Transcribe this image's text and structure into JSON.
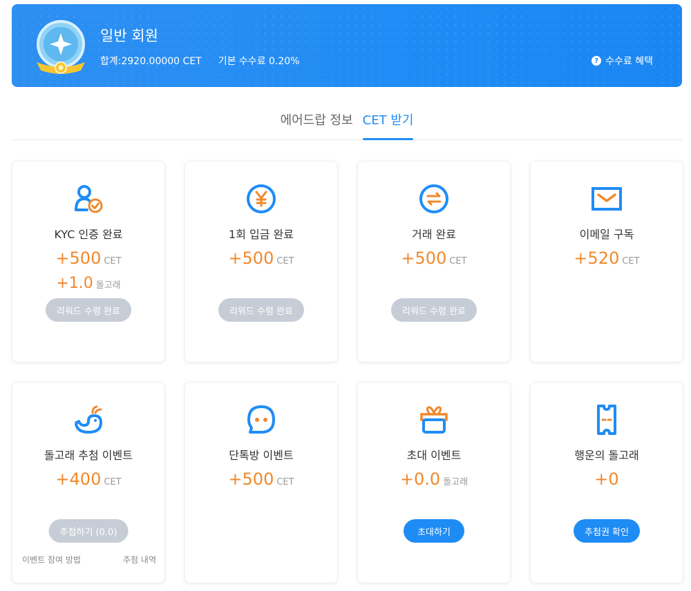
{
  "banner": {
    "title": "일반 회원",
    "total": "합계:2920.00000 CET",
    "fee": "기본 수수료 0.20%",
    "benefit_label": "수수료 혜택"
  },
  "tabs": [
    {
      "label": "에어드랍 정보"
    },
    {
      "label": "CET 받기",
      "active": true
    }
  ],
  "cards": [
    {
      "title": "KYC 인증 완료",
      "reward1": "+500",
      "unit1": "CET",
      "reward2": "+1.0",
      "unit2": "돌고래",
      "button": "리워드 수령 완료",
      "icon": "user-verified-icon"
    },
    {
      "title": "1회 입금 완료",
      "reward1": "+500",
      "unit1": "CET",
      "button": "리워드 수령 완료",
      "icon": "yen-coin-icon"
    },
    {
      "title": "거래 완료",
      "reward1": "+500",
      "unit1": "CET",
      "button": "리워드 수령 완료",
      "icon": "exchange-icon"
    },
    {
      "title": "이메일 구독",
      "reward1": "+520",
      "unit1": "CET",
      "icon": "envelope-icon"
    },
    {
      "title": "돌고래 추첨 이벤트",
      "reward1": "+400",
      "unit1": "CET",
      "button": "추첨하기 (0.0)",
      "link_left": "이벤트 참여 방법",
      "link_right": "추첨 내역",
      "icon": "whale-icon"
    },
    {
      "title": "단톡방 이벤트",
      "reward1": "+500",
      "unit1": "CET",
      "icon": "chat-bubble-icon"
    },
    {
      "title": "초대 이벤트",
      "reward1": "+0.0",
      "unit1": "돌고래",
      "button": "초대하기",
      "icon": "gift-icon"
    },
    {
      "title": "행운의 돌고래",
      "reward1": "+0",
      "button": "추첨권 확인",
      "icon": "ticket-icon"
    }
  ],
  "colors": {
    "accent": "#1f8cf5",
    "reward": "#f0882b",
    "disabled": "#c7cdd6"
  }
}
